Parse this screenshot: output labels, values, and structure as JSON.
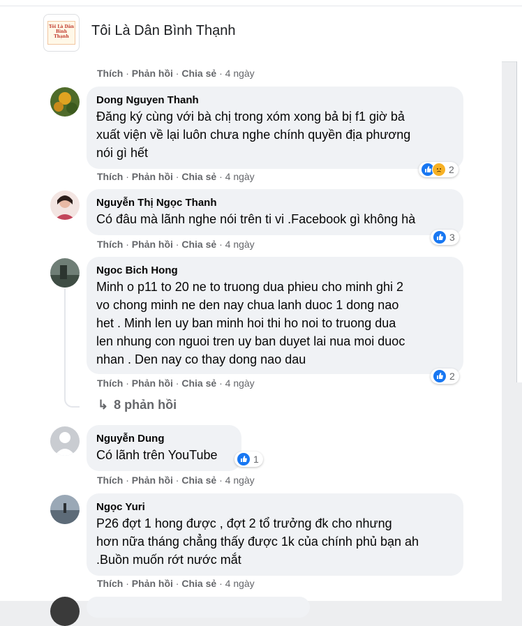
{
  "header": {
    "group_name": "Tôi Là Dân Bình Thạnh",
    "logo_text": "Tôi Là Dân Bình Thạnh"
  },
  "action_labels": {
    "like": "Thích",
    "reply": "Phản hồi",
    "share": "Chia sẻ",
    "sep": " · ",
    "time": "4 ngày"
  },
  "comments": [
    {
      "author": "Dong Nguyen Thanh",
      "lines": [
        "Đăng ký cùng với bà chị trong xóm xong bả bị f1 giờ bả",
        "xuất viện về lại luôn chưa nghe chính quyền địa phương",
        "nói gì hết"
      ],
      "reaction_count": "2",
      "avatar_color": "#6b8e23"
    },
    {
      "author": "Nguyễn Thị Ngọc Thanh",
      "lines": [
        "Có đâu mà lãnh nghe nói trên ti vi .Facebook gì không hà"
      ],
      "reaction_count": "3",
      "avatar_color": "#d9a6a0"
    },
    {
      "author": "Ngoc Bich Hong",
      "lines": [
        "Minh o p11 to 20 ne to truong dua phieu cho minh ghi 2",
        "vo chong minh ne den nay chua lanh duoc 1 dong nao",
        "het . Minh len uy ban minh hoi thi ho noi to truong dua",
        "len nhung con nguoi tren uy ban duyet lai nua moi duoc",
        "nhan . Den nay co thay dong nao dau"
      ],
      "reaction_count": "2",
      "avatar_color": "#5a6b5e"
    },
    {
      "author": "Nguyễn Dung",
      "lines": [
        "Có lãnh trên YouTube"
      ],
      "reaction_count": "1",
      "avatar_color": "#c9ccd1"
    },
    {
      "author": "Ngọc Yuri",
      "lines": [
        "P26 đợt 1 hong được , đợt 2 tổ trưởng đk cho nhưng",
        "hơn nữa tháng chẳng thấy được 1k của chính phủ bạn ah",
        ".Buồn muốn rớt nước mắt"
      ],
      "reaction_count": "",
      "avatar_color": "#7c8a99"
    }
  ],
  "replies_link": "8 phản hồi",
  "colors": {
    "like_blue": "#1877f2",
    "bubble_bg": "#f0f2f5",
    "meta_gray": "#65676b"
  }
}
